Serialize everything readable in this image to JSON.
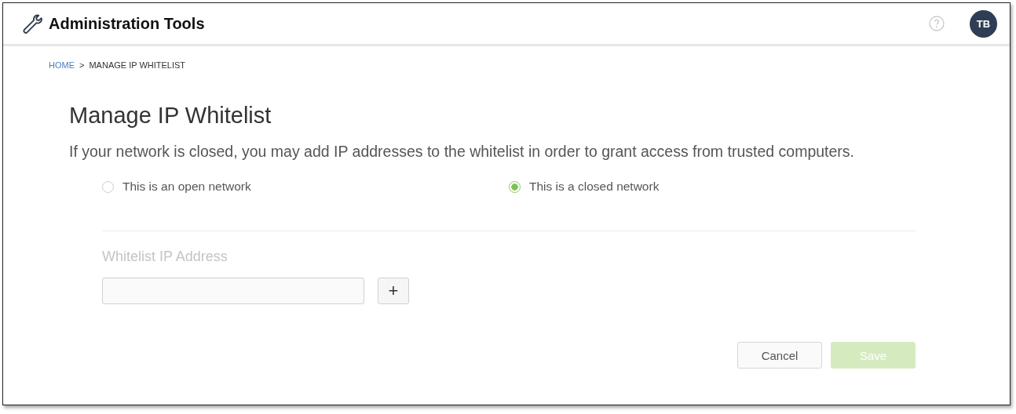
{
  "header": {
    "title": "Administration Tools",
    "avatar": "TB"
  },
  "breadcrumb": [
    {
      "label": "HOME",
      "link": true
    },
    {
      "label": ">",
      "link": false
    },
    {
      "label": "MANAGE IP WHITELIST",
      "link": false
    }
  ],
  "page": {
    "title": "Manage IP Whitelist",
    "description": "If your network is closed, you may add IP addresses to the whitelist in order to grant access from trusted computers."
  },
  "network_options": [
    {
      "label": "This is an open network",
      "selected": false
    },
    {
      "label": "This is a closed network",
      "selected": true
    }
  ],
  "whitelist": {
    "label": "Whitelist IP Address",
    "add_button": "+"
  },
  "buttons": [
    {
      "label": "Cancel",
      "kind": "secondary",
      "disabled": false
    },
    {
      "label": "Save",
      "kind": "primary",
      "disabled": true
    }
  ]
}
